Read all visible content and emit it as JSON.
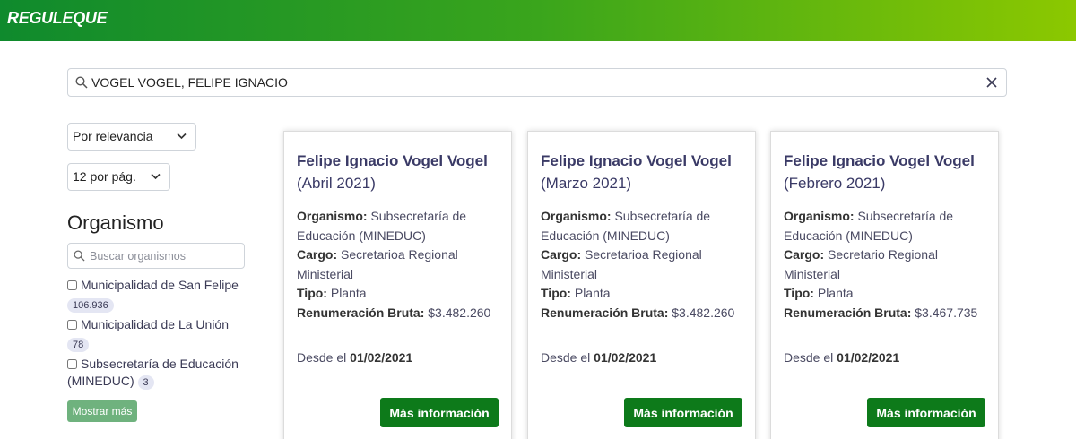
{
  "header": {
    "logo": "REGULEQUE"
  },
  "search": {
    "value": "VOGEL VOGEL, FELIPE IGNACIO"
  },
  "sort": {
    "selected": "Por relevancia"
  },
  "per_page": {
    "selected": "12 por pág."
  },
  "sidebar": {
    "title": "Organismo",
    "search_placeholder": "Buscar organismos",
    "filters": [
      {
        "label": "Municipalidad de San Felipe",
        "count": "106.936"
      },
      {
        "label": "Municipalidad de La Unión",
        "count": "78"
      },
      {
        "label": "Subsecretaría de Educación (MINEDUC)",
        "count": "3"
      }
    ],
    "show_more": "Mostrar más"
  },
  "labels": {
    "organismo": "Organismo:",
    "cargo": "Cargo:",
    "tipo": "Tipo:",
    "renumeracion": "Renumeración Bruta:",
    "desde": "Desde el",
    "more_button": "Más información"
  },
  "cards": [
    {
      "name": "Felipe Ignacio Vogel Vogel",
      "period": "(Abril 2021)",
      "organismo": "Subsecretaría de Educación (MINEDUC)",
      "cargo": "Secretarioa Regional Ministerial",
      "tipo": "Planta",
      "renumeracion": "$3.482.260",
      "desde": "01/02/2021"
    },
    {
      "name": "Felipe Ignacio Vogel Vogel",
      "period": "(Marzo 2021)",
      "organismo": "Subsecretaría de Educación (MINEDUC)",
      "cargo": "Secretarioa Regional Ministerial",
      "tipo": "Planta",
      "renumeracion": "$3.482.260",
      "desde": "01/02/2021"
    },
    {
      "name": "Felipe Ignacio Vogel Vogel",
      "period": "(Febrero 2021)",
      "organismo": "Subsecretaría de Educación (MINEDUC)",
      "cargo": "Secretario Regional Ministerial",
      "tipo": "Planta",
      "renumeracion": "$3.467.735",
      "desde": "01/02/2021"
    }
  ]
}
